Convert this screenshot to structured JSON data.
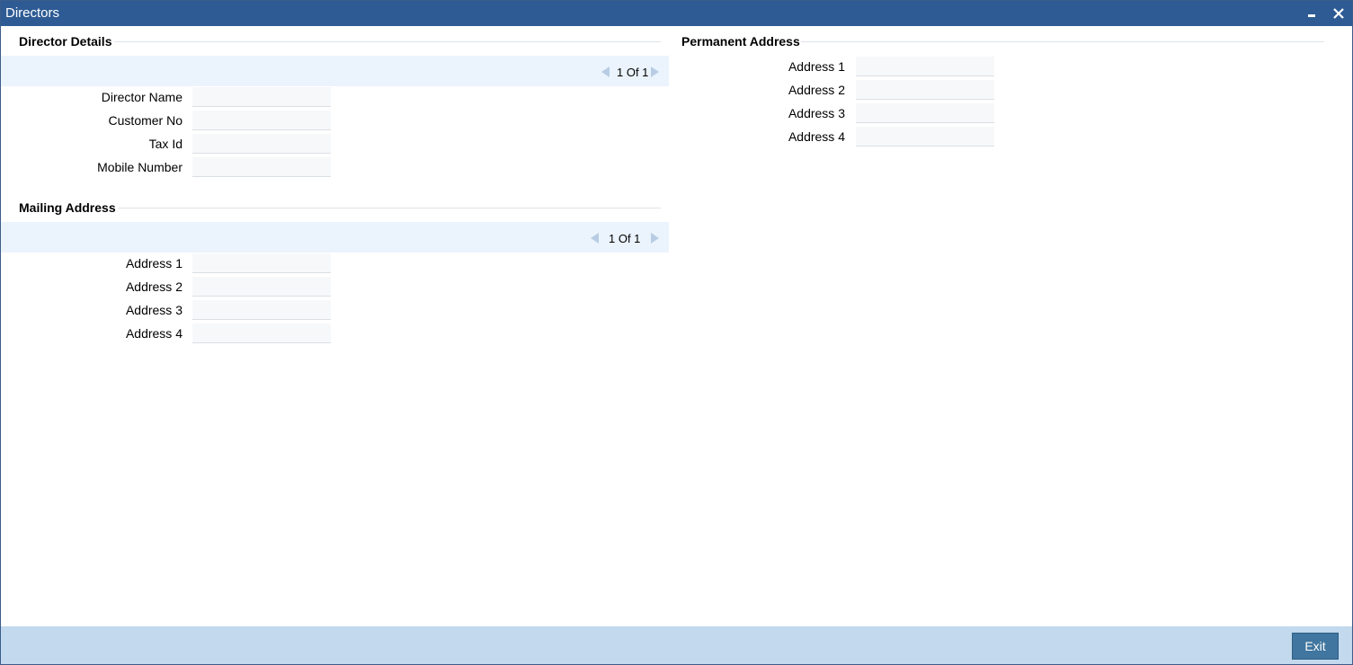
{
  "window": {
    "title": "Directors"
  },
  "director_details": {
    "heading": "Director Details",
    "pager": {
      "text": "1 Of 1"
    },
    "fields": [
      {
        "label": "Director Name",
        "value": ""
      },
      {
        "label": "Customer No",
        "value": ""
      },
      {
        "label": "Tax Id",
        "value": ""
      },
      {
        "label": "Mobile Number",
        "value": ""
      }
    ]
  },
  "mailing_address": {
    "heading": "Mailing Address",
    "pager": {
      "text": "1 Of 1"
    },
    "fields": [
      {
        "label": "Address 1",
        "value": ""
      },
      {
        "label": "Address 2",
        "value": ""
      },
      {
        "label": "Address 3",
        "value": ""
      },
      {
        "label": "Address 4",
        "value": ""
      }
    ]
  },
  "permanent_address": {
    "heading": "Permanent Address",
    "fields": [
      {
        "label": "Address 1",
        "value": ""
      },
      {
        "label": "Address 2",
        "value": ""
      },
      {
        "label": "Address 3",
        "value": ""
      },
      {
        "label": "Address 4",
        "value": ""
      }
    ]
  },
  "footer": {
    "exit_label": "Exit"
  },
  "colors": {
    "titlebar": "#2e5b94",
    "nav_band": "#ebf4fd",
    "footer": "#c2d9ee",
    "exit_button": "#40769f"
  },
  "icons": {
    "minimize": "minimize-icon",
    "close": "close-icon",
    "prev": "prev-arrow-icon",
    "next": "next-arrow-icon"
  }
}
